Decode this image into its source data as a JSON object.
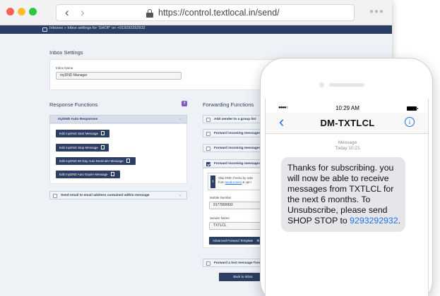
{
  "browser": {
    "url": "https://control.textlocal.in/send/",
    "back_glyph": "‹",
    "forward_glyph": "›",
    "menu_glyph": "●●●"
  },
  "app": {
    "breadcrumb": "Inboxes » Inbox settings for 'SHOP' on +919293292932",
    "inbox_settings": {
      "title": "Inbox Settings",
      "inbox_name_label": "Inbox Name",
      "inbox_name_value": "myDND Manager"
    },
    "response_functions": {
      "title": "Response Functions",
      "help": "?",
      "auto_responses_title": "myDND Auto Responses",
      "buttons": [
        "Edit myDND Start Message",
        "Edit myDND Stop Message",
        "Edit myDND 90 Day Auto Reminder Message",
        "Edit myDND Auto Expire Message"
      ],
      "send_email_label": "Send email to email address contained within message"
    },
    "forwarding_functions": {
      "title": "Forwarding Functions",
      "rows": [
        {
          "label": "Add sender to a group list",
          "checked": false
        },
        {
          "label": "Forward incoming messages to a",
          "checked": false
        },
        {
          "label": "Forward incoming messages to a",
          "checked": false
        },
        {
          "label": "Forward incoming messages to a",
          "checked": true
        }
      ],
      "info_line1": "Skip DND checks by activ",
      "info_line2_prefix": "from ",
      "info_link": "send screen",
      "info_line2_suffix": " & opt-i",
      "mobile_number_label": "Mobile Number",
      "mobile_number_value": "9177899992",
      "sender_name_label": "Sender Name",
      "sender_name_value": "TXTLCL",
      "advanced_button": "Advanced Forward Template",
      "last_row_label": "Forward a text message from a",
      "back_button": "Back to Inbox"
    }
  },
  "phone": {
    "signal": "●●●●○",
    "time": "10:29 AM",
    "contact": "DM-TXTLCL",
    "back_glyph": "‹",
    "info_glyph": "i",
    "meta_line1": "Message",
    "meta_line2": "Today 10:21",
    "message_text": "Thanks for subscribing. you will now be able to receive messages from TXTLCL for the next 6 months. To Unsubscribe, please send SHOP STOP to ",
    "message_number": "9293292932",
    "message_end": "."
  },
  "colors": {
    "navy": "#2c3e63",
    "link_blue": "#1a73e8",
    "bubble_grey": "#e5e5ea",
    "help_purple": "#7e57c2"
  }
}
